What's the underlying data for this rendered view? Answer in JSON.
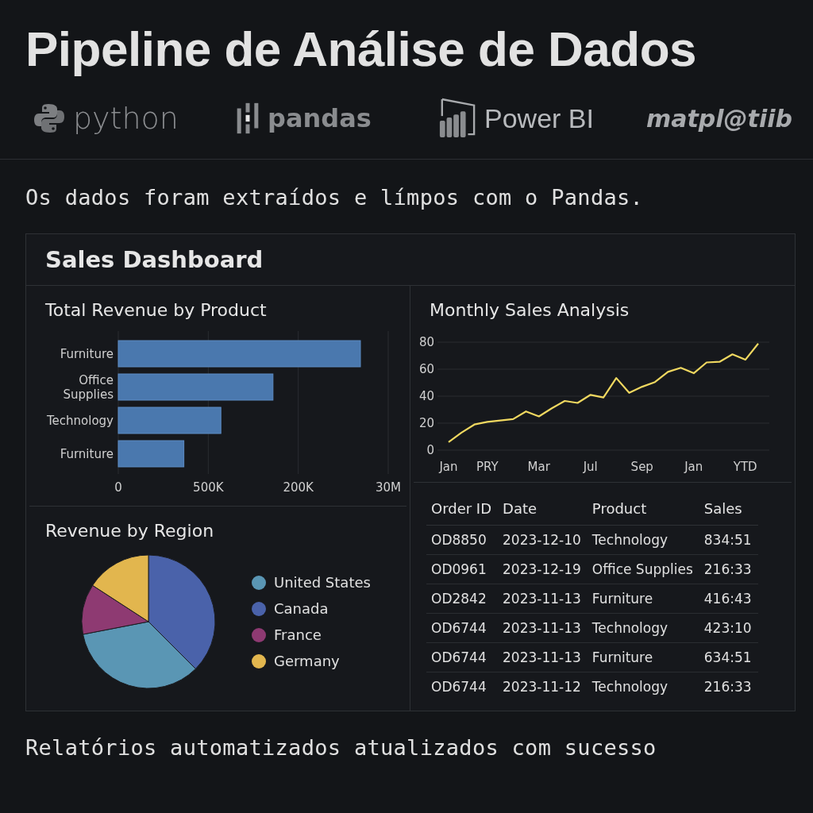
{
  "title": "Pipeline de Análise de Dados",
  "logos": [
    {
      "kind": "python",
      "label": "python"
    },
    {
      "kind": "pandas",
      "label": "pandas"
    },
    {
      "kind": "powerbi",
      "label": "Power BI"
    },
    {
      "kind": "wordmark",
      "label": "matpl@tiib"
    }
  ],
  "intro": "Os dados foram extraídos e límpos com o Pandas.",
  "dashboard": {
    "title": "Sales Dashboard",
    "revenue_by_product": {
      "title": "Total Revenue by Product",
      "bar_labels": [
        "Furniture",
        "Office Supplies",
        "Technology",
        "Furniture"
      ],
      "axis_labels": [
        "0",
        "500K",
        "200K",
        "30M"
      ]
    },
    "revenue_by_region": {
      "title": "Revenue by Region",
      "legend": [
        {
          "label": "United States",
          "color": "#5a96b4"
        },
        {
          "label": "Canada",
          "color": "#4a62aa"
        },
        {
          "label": "France",
          "color": "#8e3a72"
        },
        {
          "label": "Germany",
          "color": "#e2b64e"
        }
      ]
    },
    "monthly_sales": {
      "title": "Monthly Sales Analysis",
      "chart_data": {
        "type": "line",
        "categories": [
          "Jan",
          null,
          null,
          "PRY",
          null,
          null,
          null,
          "Mar",
          null,
          null,
          null,
          "Jul",
          null,
          null,
          null,
          "Sep",
          null,
          null,
          null,
          "Jan",
          null,
          null,
          null,
          "YTD",
          null
        ],
        "series": [
          {
            "color": "#f0d860",
            "values": [
              6,
              13,
              19,
              21,
              22,
              23,
              28.7,
              25,
              31,
              36.5,
              35,
              41,
              39,
              53.5,
              42.5,
              47,
              50.5,
              58,
              61,
              57,
              65,
              65.5,
              71,
              67,
              79
            ]
          }
        ],
        "ylim": [
          0,
          80
        ],
        "yticks": [
          0,
          20,
          40,
          60,
          80
        ],
        "grid": true
      }
    },
    "orders": {
      "columns": [
        "Order ID",
        "Date",
        "Product",
        "Sales"
      ],
      "rows": [
        [
          "OD8850",
          "2023-12-10",
          "Technology",
          "834:51"
        ],
        [
          "OD0961",
          "2023-12-19",
          "Office Supplies",
          "216:33"
        ],
        [
          "OD2842",
          "2023-11-13",
          "Furniture",
          "416:43"
        ],
        [
          "OD6744",
          "2023-11-13",
          "Technology",
          "423:10"
        ],
        [
          "OD6744",
          "2023-11-13",
          "Furniture",
          "634:51"
        ],
        [
          "OD6744",
          "2023-11-12",
          "Technology",
          "216:33"
        ]
      ]
    }
  },
  "footer": "Relatórios automatizados atualizados com sucesso"
}
